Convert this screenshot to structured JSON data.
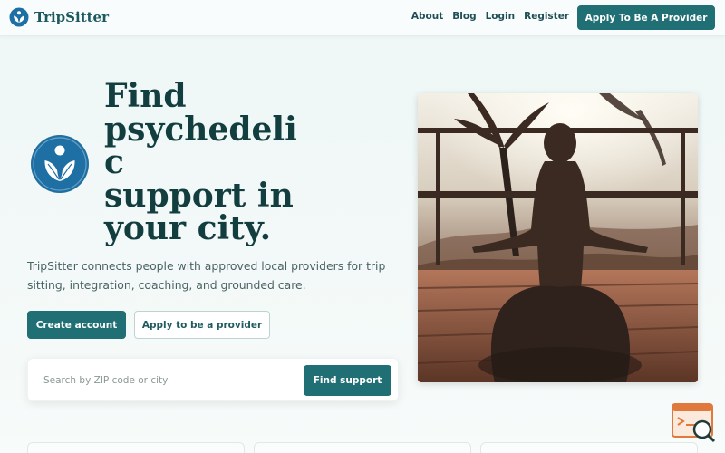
{
  "header": {
    "brand": "TripSitter",
    "nav": [
      "About",
      "Blog",
      "Login",
      "Register"
    ],
    "cta": "Apply To Be A Provider"
  },
  "hero": {
    "title_lines": [
      "Find",
      "psychedeli",
      "c",
      "support in",
      "your city."
    ],
    "subtitle": "TripSitter connects people with approved local providers for trip sitting, integration, coaching, and grounded care.",
    "primary_button": "Create account",
    "secondary_button": "Apply to be a provider"
  },
  "search": {
    "placeholder": "Search by ZIP code or city",
    "value": "",
    "button": "Find support"
  },
  "icons": {
    "brand_logo": "lotus-leaf-logo-icon",
    "hero_logo": "lotus-leaf-logo-icon",
    "help_widget": "search-help-icon"
  },
  "colors": {
    "brand": "#1f6f74",
    "title": "#123e3f",
    "widget": "#e07a3c"
  }
}
